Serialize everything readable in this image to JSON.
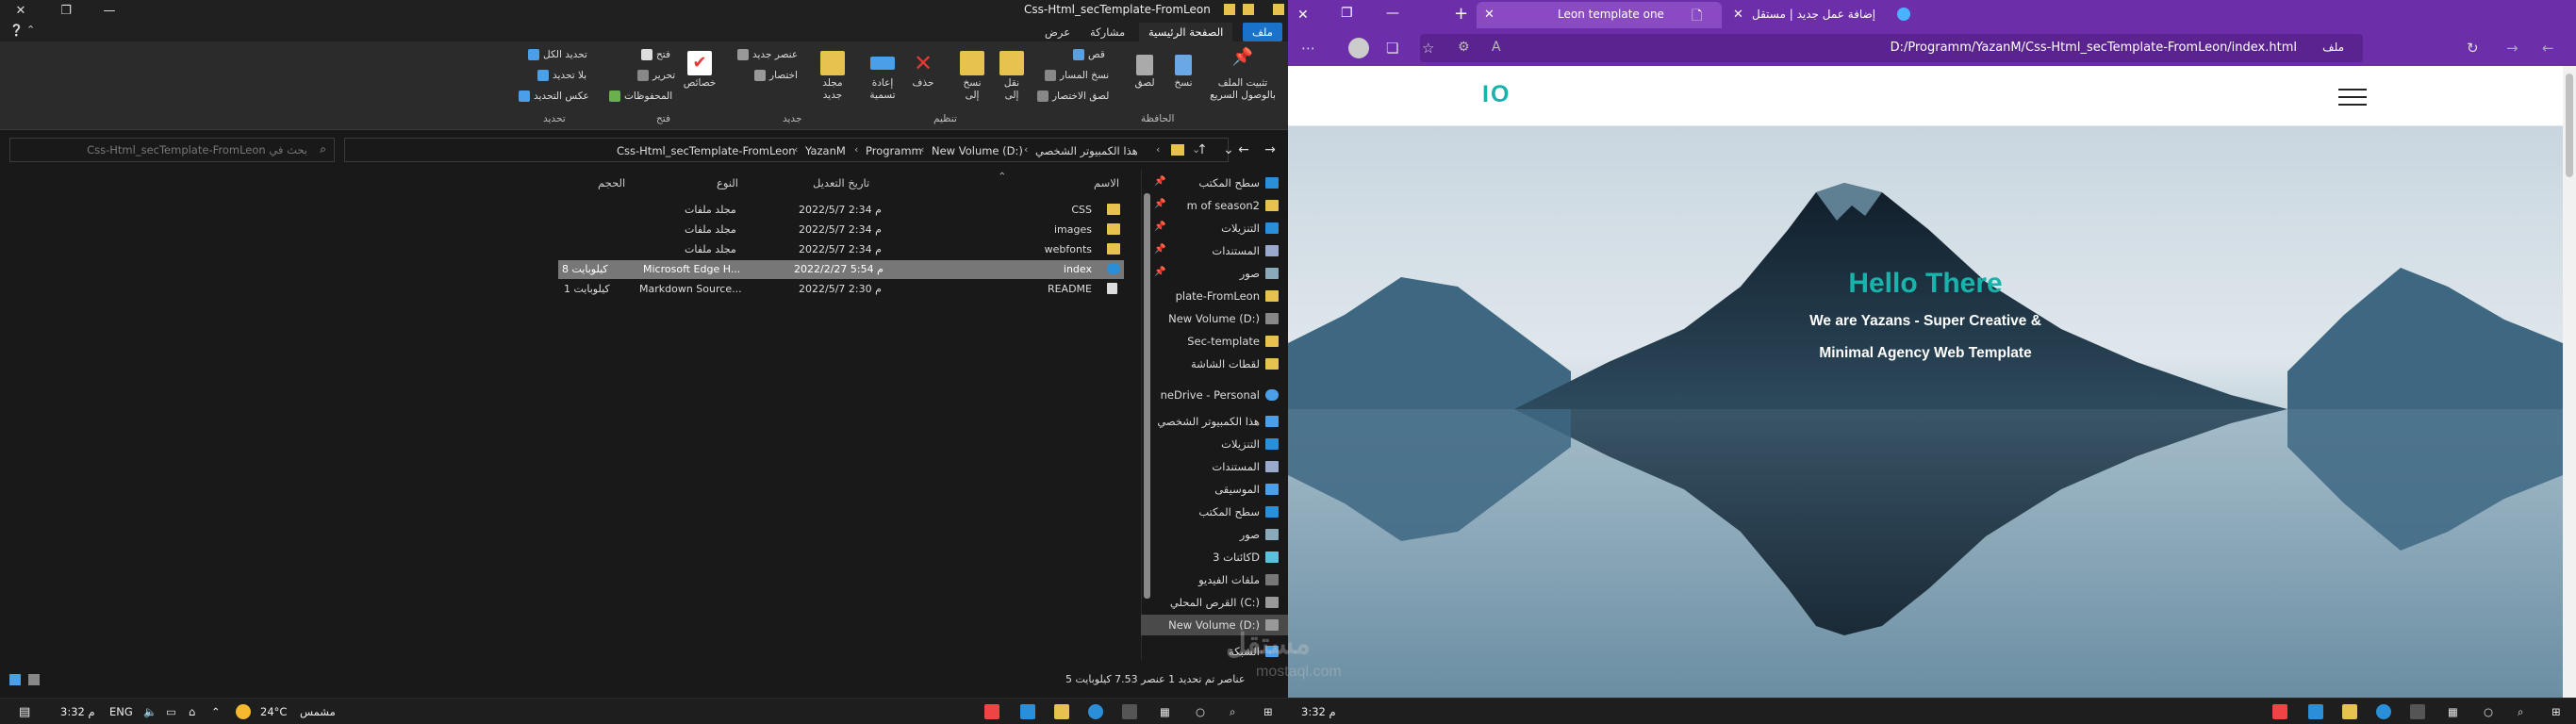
{
  "explorer": {
    "title": "Css-Html_secTemplate-FromLeon",
    "tabs": {
      "file": "ملف",
      "home": "الصفحة الرئيسية",
      "share": "مشاركة",
      "view": "عرض"
    },
    "ribbon": {
      "pin": "تثبيت الملف بالوصول السريع",
      "copy": "نسخ",
      "paste": "لصق",
      "cut": "قص",
      "copy_path": "نسخ المسار",
      "paste_shortcut": "لصق الاختصار",
      "move_to": "نقل إلى",
      "copy_to": "نسخ إلى",
      "delete": "حذف",
      "rename": "إعادة تسمية",
      "new_folder": "مجلد جديد",
      "new_item": "عنصر جديد",
      "easy_access": "اختصار",
      "properties": "خصائص",
      "open": "فتح",
      "edit": "تحرير",
      "history": "المحفوظات",
      "select_all": "تحديد الكل",
      "select_none": "بلا تحديد",
      "invert_selection": "عكس التحديد",
      "group_clipboard": "الحافظة",
      "group_organize": "تنظيم",
      "group_new": "جديد",
      "group_open": "فتح",
      "group_select": "تحديد"
    },
    "search_placeholder": "بحث في Css-Html_secTemplate-FromLeon",
    "breadcrumbs": [
      "هذا الكمبيوتر الشخصي",
      "New Volume (D:)",
      "Programm",
      "YazanM",
      "Css-Html_secTemplate-FromLeon"
    ],
    "columns": {
      "name": "الاسم",
      "modified": "تاريخ التعديل",
      "type": "النوع",
      "size": "الحجم"
    },
    "files": [
      {
        "name": "CSS",
        "modified": "2022/5/7 م 2:34",
        "type": "مجلد ملفات",
        "size": ""
      },
      {
        "name": "images",
        "modified": "2022/5/7 م 2:34",
        "type": "مجلد ملفات",
        "size": ""
      },
      {
        "name": "webfonts",
        "modified": "2022/5/7 م 2:34",
        "type": "مجلد ملفات",
        "size": ""
      },
      {
        "name": "index",
        "modified": "2022/2/27 م 5:54",
        "type": "Microsoft Edge H...",
        "size": "8 كيلوبايت"
      },
      {
        "name": "README",
        "modified": "2022/5/7 م 2:30",
        "type": "Markdown Source...",
        "size": "1 كيلوبايت"
      }
    ],
    "nav": [
      "سطح المكتب",
      "m of season2",
      "التنزيلات",
      "المستندات",
      "صور",
      "plate-FromLeon",
      "New Volume (D:)",
      "Sec-template",
      "لقطات الشاشة",
      "neDrive - Personal",
      "هذا الكمبيوتر الشخصي",
      "التنزيلات",
      "المستندات",
      "الموسيقى",
      "سطح المكتب",
      "صور",
      "كائنات 3D",
      "ملفات الفيديو",
      "القرص المحلي (C:)",
      "New Volume (D:)",
      "الشبكة"
    ],
    "status": "5 عناصر   تم تحديد 1 عنصر 7.53 كيلوبايت"
  },
  "taskbar_left": {
    "time": "3:32 م",
    "lang": "ENG",
    "temp": "24°C",
    "weather": "مشمس"
  },
  "taskbar_right": {
    "time": "3:32 م"
  },
  "browser": {
    "tab_new": "إضافة عمل جديد | مستقل",
    "tab_active": "Leon template one",
    "url": "D:/Programm/YazanM/Css-Html_secTemplate-FromLeon/index.html",
    "url_label": "ملف",
    "site": {
      "logo": "IO",
      "hero_title": "Hello There",
      "hero_sub1": "We are Yazans - Super Creative &",
      "hero_sub2": "Minimal Agency Web Template"
    }
  },
  "watermark": {
    "main": "مستقل",
    "sub": "mostaql.com"
  },
  "colors": {
    "accent": "#18b3ab",
    "browser_chrome": "#6c2ea9",
    "explorer_bg": "#191919"
  }
}
